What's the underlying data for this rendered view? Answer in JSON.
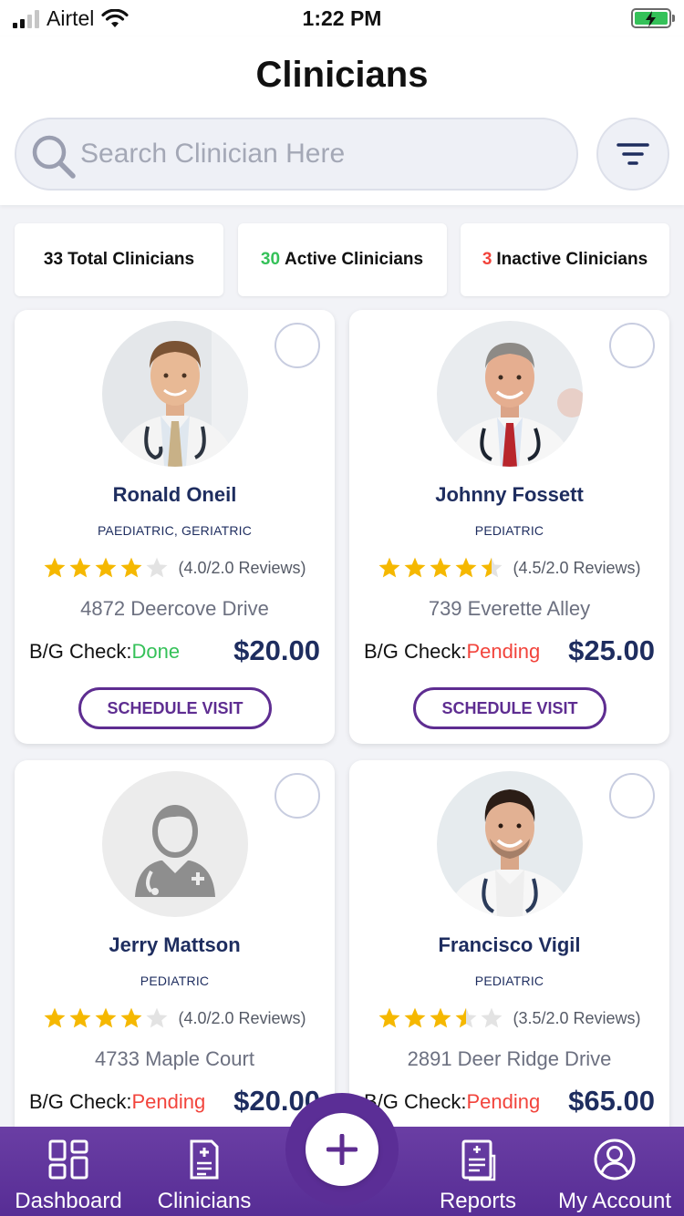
{
  "status_bar": {
    "carrier": "Airtel",
    "time": "1:22 PM"
  },
  "header": {
    "title": "Clinicians"
  },
  "search": {
    "placeholder": "Search Clinician Here",
    "value": ""
  },
  "stats": {
    "total_count": "33",
    "total_label": "Total Clinicians",
    "active_count": "30",
    "active_label": "Active Clinicians",
    "inactive_count": "3",
    "inactive_label": "Inactive Clinicians"
  },
  "labels": {
    "bg_check": "B/G Check:",
    "schedule": "SCHEDULE VISIT"
  },
  "clinicians": [
    {
      "name": "Ronald Oneil",
      "specialty": "PAEDIATRIC, GERIATRIC",
      "rating": 4.0,
      "rating_text": "(4.0/2.0 Reviews)",
      "address": "4872 Deercove Drive",
      "bg_status": "Done",
      "price": "$20.00"
    },
    {
      "name": "Johnny Fossett",
      "specialty": "PEDIATRIC",
      "rating": 4.5,
      "rating_text": "(4.5/2.0 Reviews)",
      "address": "739 Everette Alley",
      "bg_status": "Pending",
      "price": "$25.00"
    },
    {
      "name": "Jerry Mattson",
      "specialty": "PEDIATRIC",
      "rating": 4.0,
      "rating_text": "(4.0/2.0 Reviews)",
      "address": "4733 Maple Court",
      "bg_status": "Pending",
      "price": "$20.00"
    },
    {
      "name": "Francisco Vigil",
      "specialty": "PEDIATRIC",
      "rating": 3.5,
      "rating_text": "(3.5/2.0 Reviews)",
      "address": "2891 Deer Ridge Drive",
      "bg_status": "Pending",
      "price": "$65.00"
    }
  ],
  "tabs": {
    "dashboard": "Dashboard",
    "clinicians": "Clinicians",
    "reports": "Reports",
    "account": "My Account"
  },
  "colors": {
    "accent_purple": "#5e2d91",
    "navy": "#1e2d5f",
    "green": "#35c159",
    "red": "#f2443c",
    "star": "#f5b800"
  }
}
